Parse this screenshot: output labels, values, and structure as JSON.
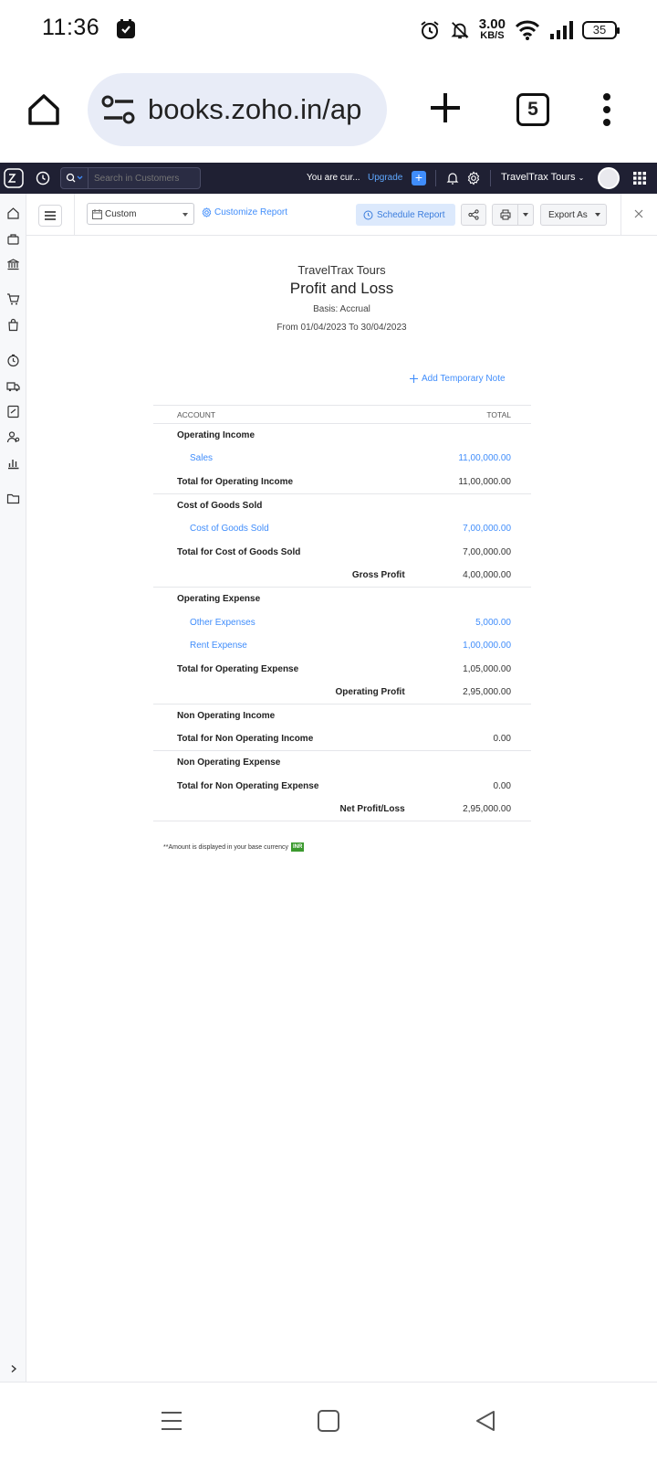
{
  "status_bar": {
    "time": "11:36",
    "net_speed": "3.00",
    "net_unit": "KB/S",
    "battery": "35",
    "icons": [
      "app-notification-icon",
      "alarm-icon",
      "bell-off-icon",
      "wifi-icon",
      "signal-icon",
      "battery-icon"
    ]
  },
  "browser": {
    "url": "books.zoho.in/ap",
    "tab_count": "5"
  },
  "app_bar": {
    "search_placeholder": "Search in Customers",
    "trial_text": "You are cur...",
    "upgrade_label": "Upgrade",
    "new_label": "+",
    "org_name": "TravelTrax Tours",
    "accent": "#408dfb",
    "bar_color": "#1f2033"
  },
  "toolbar": {
    "period_select": "Custom",
    "customize_label": "Customize Report",
    "schedule_label": "Schedule Report",
    "export_label": "Export As"
  },
  "report": {
    "org": "TravelTrax Tours",
    "title": "Profit and Loss",
    "basis": "Basis: Accrual",
    "range": "From 01/04/2023 To 30/04/2023",
    "add_note": "Add Temporary Note",
    "col_account": "ACCOUNT",
    "col_total": "TOTAL",
    "rows": [
      {
        "type": "head",
        "account": "Operating Income",
        "total": ""
      },
      {
        "type": "sub",
        "account": "Sales",
        "total": "11,00,000.00"
      },
      {
        "type": "total",
        "account": "Total for Operating Income",
        "total": "11,00,000.00"
      },
      {
        "type": "head",
        "account": "Cost of Goods Sold",
        "total": ""
      },
      {
        "type": "sub",
        "account": "Cost of Goods Sold",
        "total": "7,00,000.00"
      },
      {
        "type": "plain",
        "account": "Total for Cost of Goods Sold",
        "total": "7,00,000.00"
      },
      {
        "type": "profit",
        "account": "Gross Profit",
        "total": "4,00,000.00"
      },
      {
        "type": "head",
        "account": "Operating Expense",
        "total": ""
      },
      {
        "type": "sub",
        "account": "Other Expenses",
        "total": "5,000.00"
      },
      {
        "type": "sub",
        "account": "Rent Expense",
        "total": "1,00,000.00"
      },
      {
        "type": "plain",
        "account": "Total for Operating Expense",
        "total": "1,05,000.00"
      },
      {
        "type": "profit",
        "account": "Operating Profit",
        "total": "2,95,000.00"
      },
      {
        "type": "head",
        "account": "Non Operating Income",
        "total": ""
      },
      {
        "type": "total",
        "account": "Total for Non Operating Income",
        "total": "0.00"
      },
      {
        "type": "head",
        "account": "Non Operating Expense",
        "total": ""
      },
      {
        "type": "plain",
        "account": "Total for Non Operating Expense",
        "total": "0.00"
      },
      {
        "type": "profit",
        "account": "Net Profit/Loss",
        "total": "2,95,000.00"
      }
    ],
    "footnote": "**Amount is displayed in your base currency",
    "currency_badge": "INR"
  }
}
